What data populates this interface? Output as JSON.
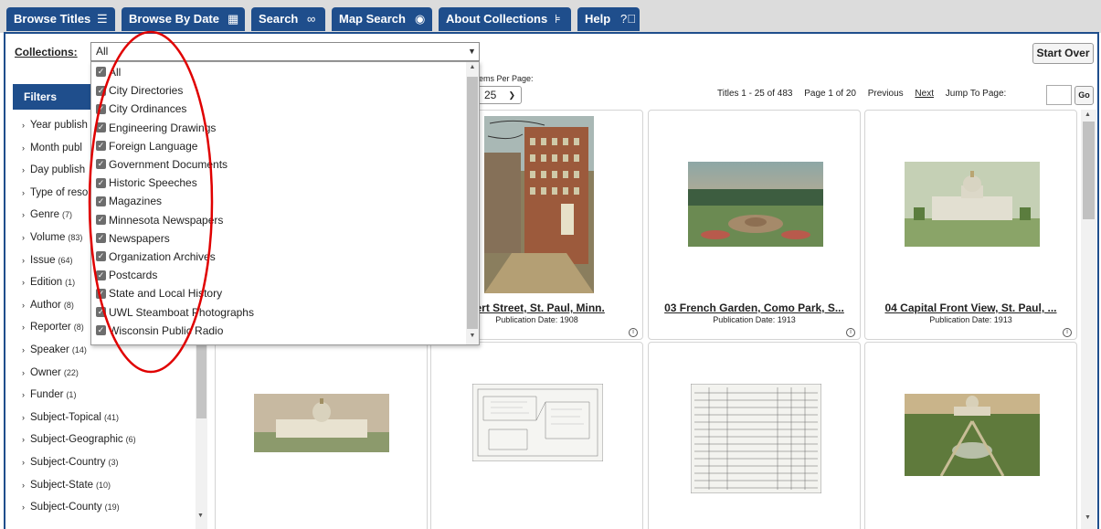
{
  "tabs": [
    {
      "label": "Browse Titles",
      "icon": "list-icon"
    },
    {
      "label": "Browse By Date",
      "icon": "calendar-icon"
    },
    {
      "label": "Search",
      "icon": "binoculars-icon"
    },
    {
      "label": "Map Search",
      "icon": "globe-icon"
    },
    {
      "label": "About Collections",
      "icon": "hierarchy-icon"
    },
    {
      "label": "Help",
      "icon": "help-circle-icon"
    }
  ],
  "collections": {
    "label": "Collections:",
    "selected": "All"
  },
  "start_over": "Start Over",
  "filters": {
    "heading": "Filters",
    "items": [
      {
        "label": "Year publish",
        "count": ""
      },
      {
        "label": "Month publ",
        "count": ""
      },
      {
        "label": "Day publish",
        "count": ""
      },
      {
        "label": "Type of reso",
        "count": ""
      },
      {
        "label": "Genre",
        "count": "(7)"
      },
      {
        "label": "Volume",
        "count": "(83)"
      },
      {
        "label": "Issue",
        "count": "(64)"
      },
      {
        "label": "Edition",
        "count": "(1)"
      },
      {
        "label": "Author",
        "count": "(8)"
      },
      {
        "label": "Reporter",
        "count": "(8)"
      },
      {
        "label": "Speaker",
        "count": "(14)"
      },
      {
        "label": "Owner",
        "count": "(22)"
      },
      {
        "label": "Funder",
        "count": "(1)"
      },
      {
        "label": "Subject-Topical",
        "count": "(41)"
      },
      {
        "label": "Subject-Geographic",
        "count": "(6)"
      },
      {
        "label": "Subject-Country",
        "count": "(3)"
      },
      {
        "label": "Subject-State",
        "count": "(10)"
      },
      {
        "label": "Subject-County",
        "count": "(19)"
      }
    ]
  },
  "items_per_page": {
    "label": "Items Per Page:",
    "value": "25"
  },
  "pager": {
    "titles": "Titles 1 - 25 of 483",
    "page": "Page 1 of 20",
    "previous": "Previous",
    "next": "Next",
    "jump_label": "Jump To Page:",
    "go": "Go"
  },
  "dropdown": {
    "options": [
      "All",
      "City Directories",
      "City Ordinances",
      "Engineering Drawings",
      "Foreign Language",
      "Government Documents",
      "Historic Speeches",
      "Magazines",
      "Minnesota Newspapers",
      "Newspapers",
      "Organization Archives",
      "Postcards",
      "State and Local History",
      "UWL Steamboat Photographs",
      "Wisconsin Public Radio"
    ]
  },
  "cards": [
    {
      "title": "bert Street, St. Paul, Minn.",
      "date": "Publication Date: 1908"
    },
    {
      "title": "03 French Garden, Como Park, S...",
      "date": "Publication Date: 1913"
    },
    {
      "title": "04 Capital Front View, St. Paul, ...",
      "date": "Publication Date: 1913"
    }
  ],
  "colors": {
    "nav": "#1f4e8c",
    "annotation": "#e00000"
  }
}
